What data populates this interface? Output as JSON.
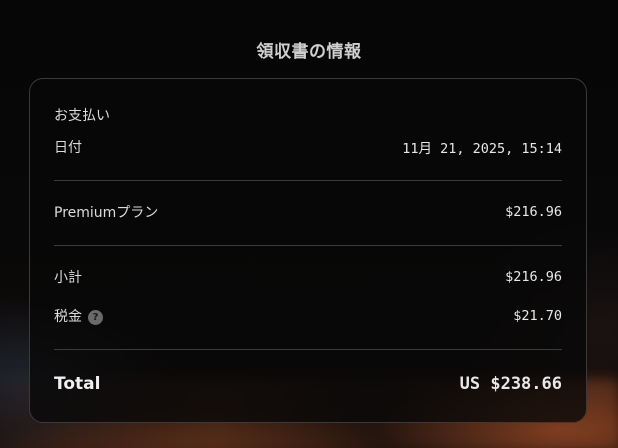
{
  "page": {
    "title": "領収書の情報"
  },
  "receipt": {
    "payment_section_label": "お支払い",
    "date_label": "日付",
    "date_value": "11月 21, 2025, 15:14",
    "plan_label": "Premiumプラン",
    "plan_price": "$216.96",
    "subtotal_label": "小計",
    "subtotal_value": "$216.96",
    "tax_label": "税金",
    "tax_help_icon": "?",
    "tax_value": "$21.70",
    "total_label": "Total",
    "total_value": "US $238.66"
  },
  "colors": {
    "background": "#070707",
    "card_border": "#3a3a3a",
    "text": "#e6e6e6"
  }
}
